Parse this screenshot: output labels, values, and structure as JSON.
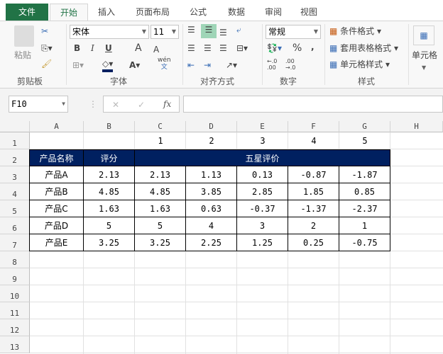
{
  "tabs": [
    "文件",
    "开始",
    "插入",
    "页面布局",
    "公式",
    "数据",
    "审阅",
    "视图"
  ],
  "ribbon": {
    "clipboard": {
      "paste": "粘贴",
      "label": "剪贴板"
    },
    "font": {
      "name": "宋体",
      "size": "11",
      "bold": "B",
      "italic": "I",
      "underline": "U",
      "grow": "A",
      "shrink": "A",
      "fontcolor": "A",
      "phonetic": "wén",
      "phonetic2": "文",
      "label": "字体"
    },
    "alignment": {
      "label": "对齐方式"
    },
    "number": {
      "format": "常规",
      "percent": "%",
      "comma": ",",
      "inc": "←.0 .00",
      "dec": ".00 →.0",
      "label": "数字"
    },
    "styles": {
      "conditional": "条件格式",
      "table": "套用表格格式",
      "cell": "单元格样式",
      "label": "样式"
    },
    "cells": {
      "label": "单元格"
    }
  },
  "formula_bar": {
    "name_box": "F10",
    "cancel": "✕",
    "enter": "✓",
    "fx": "fx",
    "value": ""
  },
  "columns": [
    "A",
    "B",
    "C",
    "D",
    "E",
    "F",
    "G",
    "H"
  ],
  "rows": [
    "1",
    "2",
    "3",
    "4",
    "5",
    "6",
    "7",
    "8",
    "9",
    "10",
    "11",
    "12",
    "13"
  ],
  "sheet": {
    "row1": [
      "",
      "",
      "1",
      "2",
      "3",
      "4",
      "5"
    ],
    "header": {
      "name": "产品名称",
      "score": "评分",
      "stars": "五星评价"
    },
    "data": [
      [
        "产品A",
        "2.13",
        "2.13",
        "1.13",
        "0.13",
        "-0.87",
        "-1.87"
      ],
      [
        "产品B",
        "4.85",
        "4.85",
        "3.85",
        "2.85",
        "1.85",
        "0.85"
      ],
      [
        "产品C",
        "1.63",
        "1.63",
        "0.63",
        "-0.37",
        "-1.37",
        "-2.37"
      ],
      [
        "产品D",
        "5",
        "5",
        "4",
        "3",
        "2",
        "1"
      ],
      [
        "产品E",
        "3.25",
        "3.25",
        "2.25",
        "1.25",
        "0.25",
        "-0.75"
      ]
    ]
  },
  "colors": {
    "header_bg": "#002060",
    "excel_green": "#217346"
  }
}
